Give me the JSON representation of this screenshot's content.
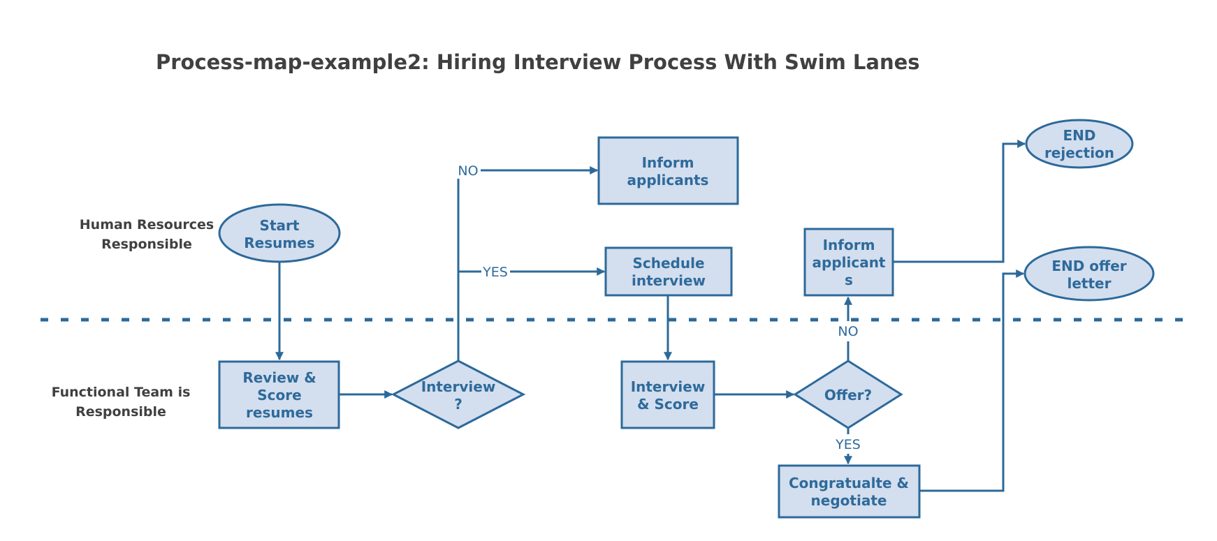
{
  "title": "Process-map-example2: Hiring Interview Process With Swim Lanes",
  "colors": {
    "stroke": "#2c699a",
    "fill": "#d3deee",
    "node_text": "#2e6a9b",
    "label_text": "#404040"
  },
  "lanes": [
    {
      "id": "hr",
      "label_lines": [
        "Human Resources",
        "Responsible"
      ]
    },
    {
      "id": "functional",
      "label_lines": [
        "Functional Team is",
        "Responsible"
      ]
    }
  ],
  "nodes": {
    "start": {
      "shape": "ellipse",
      "lane": "hr",
      "lines": [
        "Start",
        "Resumes"
      ]
    },
    "review": {
      "shape": "rect",
      "lane": "functional",
      "lines": [
        "Review &",
        "Score",
        "resumes"
      ]
    },
    "interview_decision": {
      "shape": "diamond",
      "lane": "functional",
      "lines": [
        "Interview",
        "?"
      ]
    },
    "inform_rejected": {
      "shape": "rect",
      "lane": "hr",
      "lines": [
        "Inform",
        "applicants"
      ]
    },
    "schedule": {
      "shape": "rect",
      "lane": "hr",
      "lines": [
        "Schedule",
        "interview"
      ]
    },
    "interview_score": {
      "shape": "rect",
      "lane": "functional",
      "lines": [
        "Interview",
        "& Score"
      ]
    },
    "offer_decision": {
      "shape": "diamond",
      "lane": "functional",
      "lines": [
        "Offer?"
      ]
    },
    "inform_no_offer": {
      "shape": "rect",
      "lane": "hr",
      "lines": [
        "Inform",
        "applicant",
        "s"
      ]
    },
    "congratulate": {
      "shape": "rect",
      "lane": "functional",
      "lines": [
        "Congratualte &",
        "negotiate"
      ]
    },
    "end_rejection": {
      "shape": "ellipse",
      "lane": "hr",
      "lines": [
        "END",
        "rejection"
      ]
    },
    "end_offer": {
      "shape": "ellipse",
      "lane": "hr",
      "lines": [
        "END offer",
        "letter"
      ]
    }
  },
  "edges": [
    {
      "from": "start",
      "to": "review",
      "label": ""
    },
    {
      "from": "review",
      "to": "interview_decision",
      "label": ""
    },
    {
      "from": "interview_decision",
      "to": "inform_rejected",
      "label": "NO"
    },
    {
      "from": "interview_decision",
      "to": "schedule",
      "label": "YES"
    },
    {
      "from": "schedule",
      "to": "interview_score",
      "label": ""
    },
    {
      "from": "interview_score",
      "to": "offer_decision",
      "label": ""
    },
    {
      "from": "offer_decision",
      "to": "inform_no_offer",
      "label": "NO"
    },
    {
      "from": "offer_decision",
      "to": "congratulate",
      "label": "YES"
    },
    {
      "from": "inform_no_offer",
      "to": "end_rejection",
      "label": ""
    },
    {
      "from": "congratulate",
      "to": "end_offer",
      "label": ""
    }
  ]
}
